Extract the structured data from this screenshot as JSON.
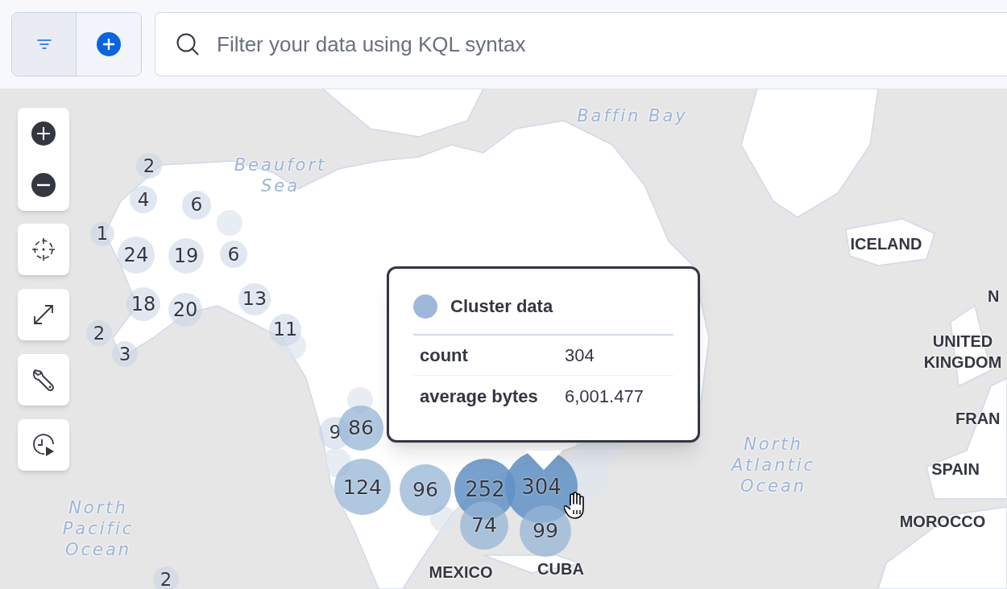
{
  "query_bar": {
    "placeholder": "Filter your data using KQL syntax"
  },
  "map": {
    "labels": [
      {
        "text": "Baffin Bay",
        "kind": "water"
      },
      {
        "text": "Beaufort Sea",
        "kind": "water"
      },
      {
        "text": "North Atlantic Ocean",
        "kind": "water"
      },
      {
        "text": "North Pacific Ocean",
        "kind": "water"
      },
      {
        "text": "ICELAND",
        "kind": "country"
      },
      {
        "text": "N",
        "kind": "country"
      },
      {
        "text": "UNITED KINGDOM",
        "kind": "country"
      },
      {
        "text": "FRAN",
        "kind": "country"
      },
      {
        "text": "SPAIN",
        "kind": "country"
      },
      {
        "text": "MOROCCO",
        "kind": "country"
      },
      {
        "text": "MEXICO",
        "kind": "country"
      },
      {
        "text": "CUBA",
        "kind": "country"
      }
    ],
    "clusters": [
      {
        "count": "2"
      },
      {
        "count": "4"
      },
      {
        "count": "6"
      },
      {
        "count": "1"
      },
      {
        "count": "24"
      },
      {
        "count": "19"
      },
      {
        "count": "6"
      },
      {
        "count": "18"
      },
      {
        "count": "20"
      },
      {
        "count": "13"
      },
      {
        "count": "11"
      },
      {
        "count": "2"
      },
      {
        "count": "3"
      },
      {
        "count": "9"
      },
      {
        "count": "86"
      },
      {
        "count": "124"
      },
      {
        "count": "96"
      },
      {
        "count": "252"
      },
      {
        "count": "304"
      },
      {
        "count": "74"
      },
      {
        "count": "99"
      },
      {
        "count": "2"
      }
    ],
    "tooltip": {
      "title": "Cluster data",
      "rows": [
        {
          "label": "count",
          "value": "304"
        },
        {
          "label": "average bytes",
          "value": "6,001.477"
        }
      ]
    }
  }
}
